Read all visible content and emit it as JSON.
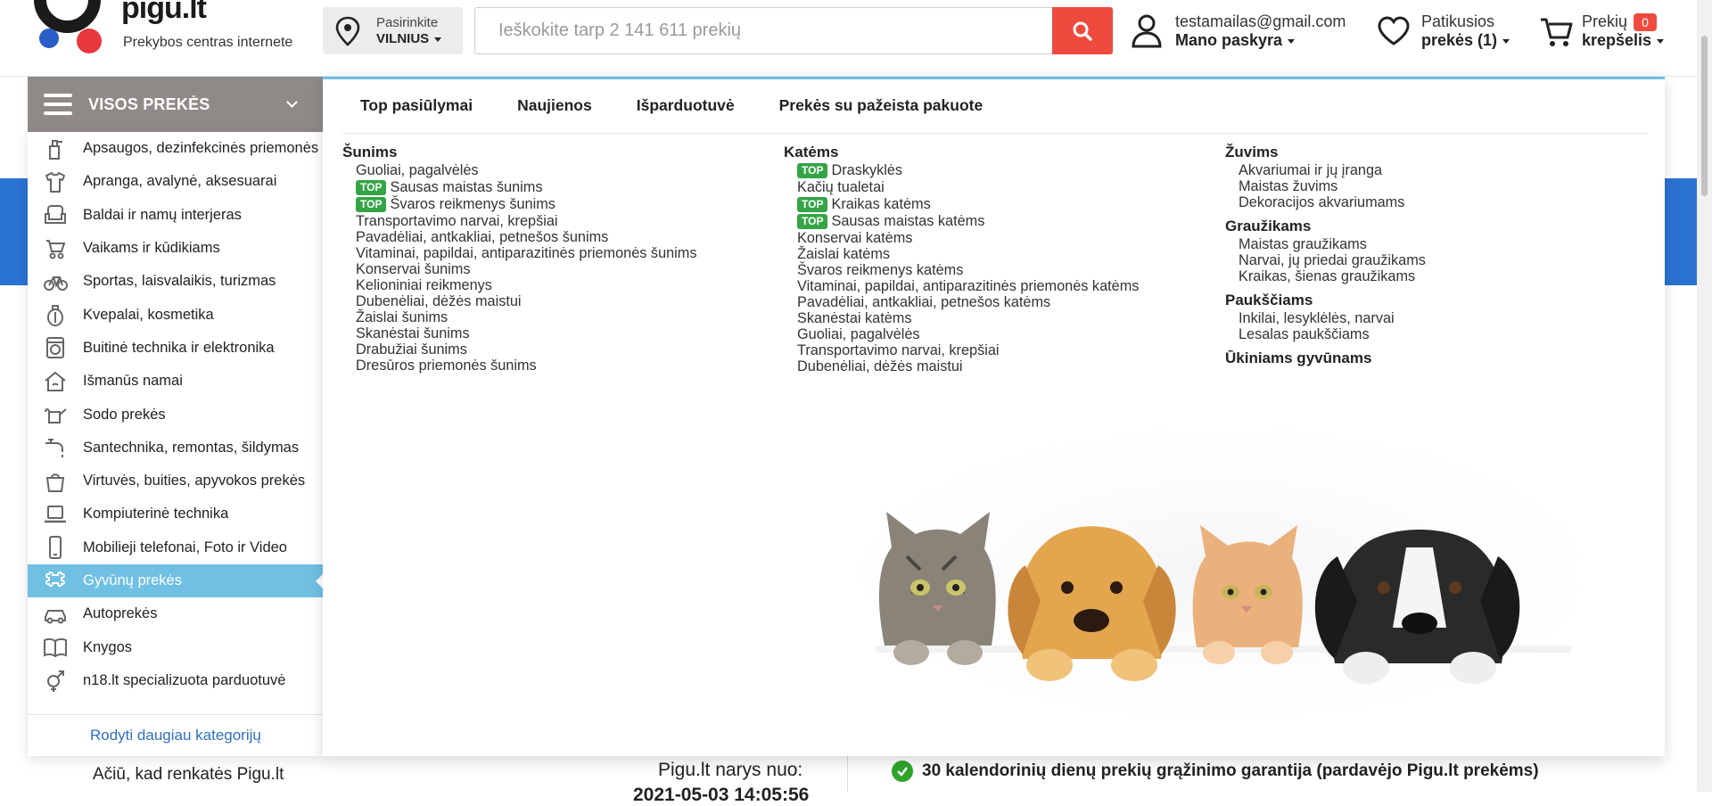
{
  "header": {
    "logo_text": "pigu.lt",
    "tagline": "Prekybos centras internete",
    "city_label": "Pasirinkite",
    "city_value": "VILNIUS",
    "search_placeholder": "Ieškokite tarp 2 141 611 prekių",
    "account_email": "testamailas@gmail.com",
    "account_label": "Mano paskyra",
    "favorites_line1": "Patikusios",
    "favorites_line2": "prekės (1)",
    "cart_line1": "Prekių",
    "cart_count": "0",
    "cart_line2": "krepšelis"
  },
  "sidebar": {
    "header_label": "VISOS PREKĖS",
    "items": [
      {
        "label": "Apsaugos, dezinfekcinės priemonės",
        "icon": "sanitizer-icon"
      },
      {
        "label": "Apranga, avalynė, aksesuarai",
        "icon": "tshirt-icon"
      },
      {
        "label": "Baldai ir namų interjeras",
        "icon": "armchair-icon"
      },
      {
        "label": "Vaikams ir kūdikiams",
        "icon": "stroller-icon"
      },
      {
        "label": "Sportas, laisvalaikis, turizmas",
        "icon": "bicycle-icon"
      },
      {
        "label": "Kvepalai, kosmetika",
        "icon": "perfume-icon"
      },
      {
        "label": "Buitinė technika ir elektronika",
        "icon": "washing-machine-icon"
      },
      {
        "label": "Išmanūs namai",
        "icon": "smart-home-icon"
      },
      {
        "label": "Sodo prekės",
        "icon": "watering-can-icon"
      },
      {
        "label": "Santechnika, remontas, šildymas",
        "icon": "faucet-icon"
      },
      {
        "label": "Virtuvės, buities, apyvokos prekės",
        "icon": "pot-icon"
      },
      {
        "label": "Kompiuterinė technika",
        "icon": "laptop-icon"
      },
      {
        "label": "Mobilieji telefonai, Foto ir Video",
        "icon": "phone-icon"
      },
      {
        "label": "Gyvūnų prekės",
        "icon": "bone-icon",
        "active": true
      },
      {
        "label": "Autoprekės",
        "icon": "car-icon"
      },
      {
        "label": "Knygos",
        "icon": "book-icon"
      },
      {
        "label": "n18.lt specializuota parduotuvė",
        "icon": "gender-icon"
      }
    ],
    "more_label": "Rodyti daugiau kategorijų"
  },
  "mega": {
    "tabs": [
      "Top pasiūlymai",
      "Naujienos",
      "Išparduotuvė",
      "Prekės su pažeista pakuote"
    ],
    "top_badge": "TOP",
    "columns": [
      {
        "groups": [
          {
            "title": "Šunims",
            "items": [
              {
                "label": "Guoliai, pagalvėlės",
                "top": false
              },
              {
                "label": "Sausas maistas šunims",
                "top": true
              },
              {
                "label": "Švaros reikmenys šunims",
                "top": true
              },
              {
                "label": "Transportavimo narvai, krepšiai",
                "top": false
              },
              {
                "label": "Pavadėliai, antkakliai, petnešos šunims",
                "top": false
              },
              {
                "label": "Vitaminai, papildai, antiparazitinės priemonės šunims",
                "top": false
              },
              {
                "label": "Konservai šunims",
                "top": false
              },
              {
                "label": "Kelioniniai reikmenys",
                "top": false
              },
              {
                "label": "Dubenėliai, dėžės maistui",
                "top": false
              },
              {
                "label": "Žaislai šunims",
                "top": false
              },
              {
                "label": "Skanėstai šunims",
                "top": false
              },
              {
                "label": "Drabužiai šunims",
                "top": false
              },
              {
                "label": "Dresūros priemonės šunims",
                "top": false
              }
            ]
          }
        ]
      },
      {
        "groups": [
          {
            "title": "Katėms",
            "items": [
              {
                "label": "Draskyklės",
                "top": true
              },
              {
                "label": "Kačių tualetai",
                "top": false
              },
              {
                "label": "Kraikas katėms",
                "top": true
              },
              {
                "label": "Sausas maistas katėms",
                "top": true
              },
              {
                "label": "Konservai katėms",
                "top": false
              },
              {
                "label": "Žaislai katėms",
                "top": false
              },
              {
                "label": "Švaros reikmenys katėms",
                "top": false
              },
              {
                "label": "Vitaminai, papildai, antiparazitinės priemonės katėms",
                "top": false
              },
              {
                "label": "Pavadėliai, antkakliai, petnešos katėms",
                "top": false
              },
              {
                "label": "Skanėstai katėms",
                "top": false
              },
              {
                "label": "Guoliai, pagalvėlės",
                "top": false
              },
              {
                "label": "Transportavimo narvai, krepšiai",
                "top": false
              },
              {
                "label": "Dubenėliai, dėžės maistui",
                "top": false
              }
            ]
          }
        ]
      },
      {
        "groups": [
          {
            "title": "Žuvims",
            "items": [
              {
                "label": "Akvariumai ir jų įranga",
                "top": false
              },
              {
                "label": "Maistas žuvims",
                "top": false
              },
              {
                "label": "Dekoracijos akvariumams",
                "top": false
              }
            ]
          },
          {
            "title": "Graužikams",
            "items": [
              {
                "label": "Maistas graužikams",
                "top": false
              },
              {
                "label": "Narvai, jų priedai graužikams",
                "top": false
              },
              {
                "label": "Kraikas, šienas graužikams",
                "top": false
              }
            ]
          },
          {
            "title": "Paukščiams",
            "items": [
              {
                "label": "Inkilai, lesyklėlės, narvai",
                "top": false
              },
              {
                "label": "Lesalas paukščiams",
                "top": false
              }
            ]
          },
          {
            "title": "Ūkiniams gyvūnams",
            "items": []
          }
        ]
      }
    ]
  },
  "background": {
    "thanks": "Ačiū, kad renkatės Pigu.lt",
    "member_since_label": "Pigu.lt narys nuo:",
    "member_since_value": "2021-05-03 14:05:56",
    "guarantee": "30 kalendorinių dienų prekių grąžinimo garantija (pardavėjo Pigu.lt prekėms)"
  },
  "colors": {
    "accent_blue": "#6fc0e3",
    "search_red": "#ee4b3e",
    "top_green": "#35a447",
    "link_blue": "#2f6fc1",
    "brand_blue": "#2b73d1"
  }
}
